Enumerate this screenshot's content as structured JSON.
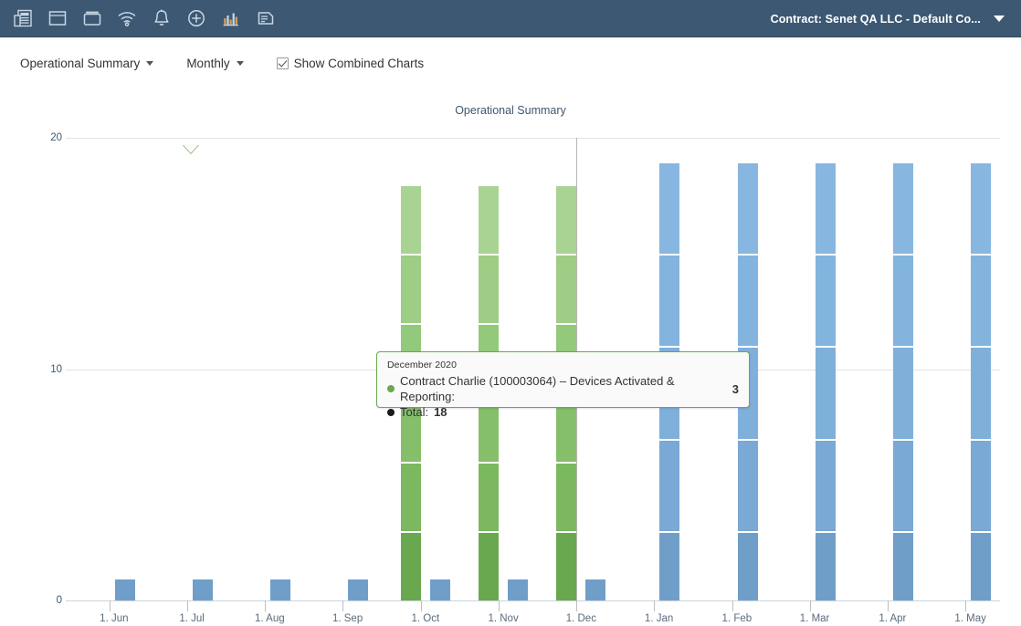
{
  "topbar": {
    "icons": [
      {
        "name": "reports-icon",
        "label": "Reports"
      },
      {
        "name": "window-icon",
        "label": "Window"
      },
      {
        "name": "folder-window-icon",
        "label": "Devices"
      },
      {
        "name": "wifi-icon",
        "label": "Network"
      },
      {
        "name": "bell-icon",
        "label": "Alerts"
      },
      {
        "name": "plus-circle-icon",
        "label": "Add"
      },
      {
        "name": "bar-chart-icon",
        "label": "Analytics"
      },
      {
        "name": "document-icon",
        "label": "Documents"
      }
    ],
    "contract_label": "Contract: Senet QA LLC - Default Co...",
    "caret_icon": "chevron-down-icon",
    "background": "#3d5873"
  },
  "toolbar": {
    "report_dropdown": "Operational Summary",
    "period_dropdown": "Monthly",
    "combined_charts_label": "Show Combined Charts",
    "combined_charts_checked": true
  },
  "tooltip": {
    "date": "December 2020",
    "rows": [
      {
        "dot_color": "#6aa84f",
        "label": "Contract Charlie (100003064) – Devices Activated & Reporting:",
        "value": "3"
      },
      {
        "dot_color": "#1a1a1a",
        "label": "Total:",
        "value": "18"
      }
    ]
  },
  "chart_data": {
    "type": "bar",
    "title": "Operational Summary",
    "xlabel": "",
    "ylabel": "",
    "ylim": [
      0,
      20
    ],
    "yticks": [
      0,
      10,
      20
    ],
    "ytick_labels": [
      "0",
      "10",
      "20"
    ],
    "grid": true,
    "stacked": true,
    "legend": "none",
    "categories": [
      "1. Jun",
      "1. Jul",
      "1. Aug",
      "1. Sep",
      "1. Oct",
      "1. Nov",
      "1. Dec",
      "1. Jan",
      "1. Feb",
      "1. Mar",
      "1. Apr",
      "1. May"
    ],
    "highlighted_category": "1. Dec",
    "colors": {
      "green_primary": "#6aa84f",
      "green_segment": "#7cb85f",
      "green_light": "#92c97a",
      "green_lighter": "#9ecd86",
      "blue_primary": "#6f9fc8",
      "blue_segment": "#79a9d4",
      "blue_light": "#85b3dd",
      "axis_text": "#3e576f"
    },
    "series": [
      {
        "name": "Devices Activated & Reporting (green series)",
        "color": "#6aa84f",
        "values": [
          0,
          0,
          0,
          0,
          18,
          18,
          18,
          0,
          0,
          0,
          0,
          0
        ],
        "segments": [
          [],
          [],
          [],
          [],
          [
            3,
            3,
            3,
            3,
            3,
            3
          ],
          [
            3,
            3,
            3,
            3,
            3,
            3
          ],
          [
            3,
            3,
            3,
            3,
            3,
            3
          ],
          [],
          [],
          [],
          [],
          []
        ]
      },
      {
        "name": "Devices (blue series)",
        "color": "#6f9fc8",
        "values": [
          1,
          1,
          1,
          1,
          1,
          1,
          1,
          19,
          19,
          19,
          19,
          19
        ],
        "segments": [
          [
            1
          ],
          [
            1
          ],
          [
            1
          ],
          [
            1
          ],
          [
            1
          ],
          [
            1
          ],
          [
            1
          ],
          [
            3,
            4,
            4,
            4,
            4
          ],
          [
            3,
            4,
            4,
            4,
            4
          ],
          [
            3,
            4,
            4,
            4,
            4
          ],
          [
            3,
            4,
            4,
            4,
            4
          ],
          [
            3,
            4,
            4,
            4,
            4
          ]
        ]
      }
    ]
  }
}
